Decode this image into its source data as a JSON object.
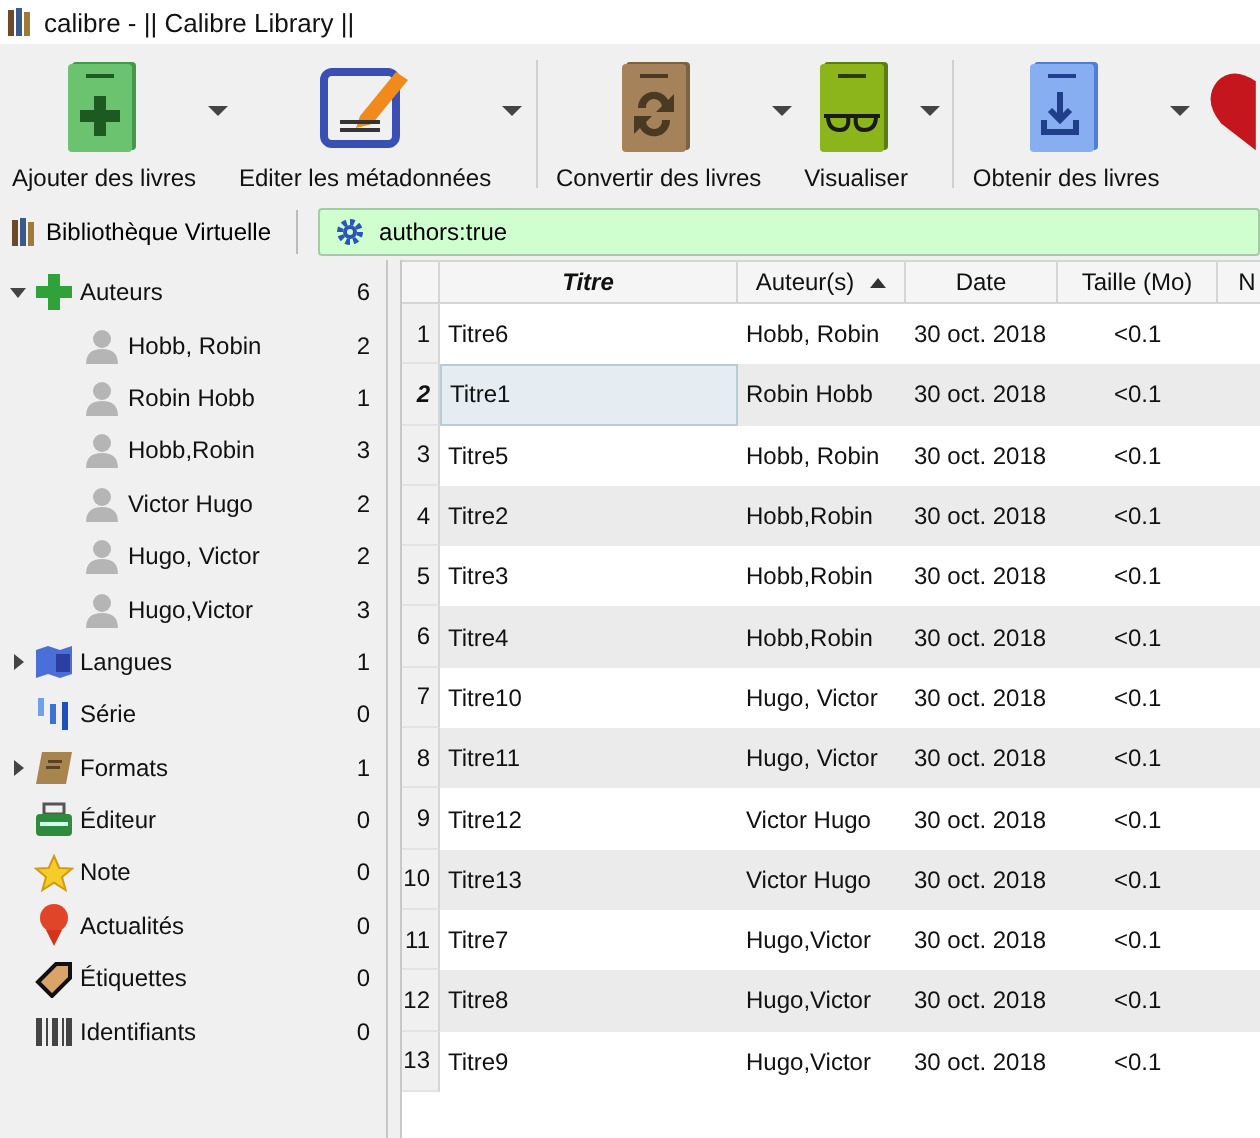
{
  "window": {
    "title": "calibre - || Calibre Library ||"
  },
  "toolbar": [
    {
      "label": "Ajouter des livres"
    },
    {
      "label": "Editer les métadonnées"
    },
    {
      "label": "Convertir des livres"
    },
    {
      "label": "Visualiser"
    },
    {
      "label": "Obtenir des livres"
    }
  ],
  "virtual_library": {
    "label": "Bibliothèque Virtuelle"
  },
  "search": {
    "value": "authors:true"
  },
  "sidebar": {
    "items": [
      {
        "label": "Auteurs",
        "count": "6",
        "kind": "branch",
        "expanded": true,
        "children": [
          {
            "label": "Hobb, Robin",
            "count": "2"
          },
          {
            "label": "Robin Hobb",
            "count": "1"
          },
          {
            "label": "Hobb,Robin",
            "count": "3"
          },
          {
            "label": "Victor Hugo",
            "count": "2"
          },
          {
            "label": "Hugo, Victor",
            "count": "2"
          },
          {
            "label": "Hugo,Victor",
            "count": "3"
          }
        ]
      },
      {
        "label": "Langues",
        "count": "1",
        "kind": "branch",
        "expanded": false
      },
      {
        "label": "Série",
        "count": "0",
        "kind": "leaf"
      },
      {
        "label": "Formats",
        "count": "1",
        "kind": "branch",
        "expanded": false
      },
      {
        "label": "Éditeur",
        "count": "0",
        "kind": "leaf"
      },
      {
        "label": "Note",
        "count": "0",
        "kind": "leaf"
      },
      {
        "label": "Actualités",
        "count": "0",
        "kind": "leaf"
      },
      {
        "label": "Étiquettes",
        "count": "0",
        "kind": "leaf"
      },
      {
        "label": "Identifiants",
        "count": "0",
        "kind": "leaf"
      }
    ]
  },
  "table": {
    "columns": [
      {
        "label": "Titre",
        "sorted": false
      },
      {
        "label": "Auteur(s)",
        "sorted": true
      },
      {
        "label": "Date",
        "sorted": false
      },
      {
        "label": "Taille (Mo)",
        "sorted": false
      },
      {
        "label": "N",
        "sorted": false
      }
    ],
    "rows": [
      {
        "number": "1",
        "title": "Titre6",
        "author": "Hobb, Robin",
        "date": "30 oct. 2018",
        "size": "<0.1",
        "selected": false
      },
      {
        "number": "2",
        "title": "Titre1",
        "author": "Robin Hobb",
        "date": "30 oct. 2018",
        "size": "<0.1",
        "selected": true
      },
      {
        "number": "3",
        "title": "Titre5",
        "author": "Hobb, Robin",
        "date": "30 oct. 2018",
        "size": "<0.1",
        "selected": false
      },
      {
        "number": "4",
        "title": "Titre2",
        "author": "Hobb,Robin",
        "date": "30 oct. 2018",
        "size": "<0.1",
        "selected": false
      },
      {
        "number": "5",
        "title": "Titre3",
        "author": "Hobb,Robin",
        "date": "30 oct. 2018",
        "size": "<0.1",
        "selected": false
      },
      {
        "number": "6",
        "title": "Titre4",
        "author": "Hobb,Robin",
        "date": "30 oct. 2018",
        "size": "<0.1",
        "selected": false
      },
      {
        "number": "7",
        "title": "Titre10",
        "author": "Hugo, Victor",
        "date": "30 oct. 2018",
        "size": "<0.1",
        "selected": false
      },
      {
        "number": "8",
        "title": "Titre11",
        "author": "Hugo, Victor",
        "date": "30 oct. 2018",
        "size": "<0.1",
        "selected": false
      },
      {
        "number": "9",
        "title": "Titre12",
        "author": "Victor Hugo",
        "date": "30 oct. 2018",
        "size": "<0.1",
        "selected": false
      },
      {
        "number": "10",
        "title": "Titre13",
        "author": "Victor Hugo",
        "date": "30 oct. 2018",
        "size": "<0.1",
        "selected": false
      },
      {
        "number": "11",
        "title": "Titre7",
        "author": "Hugo,Victor",
        "date": "30 oct. 2018",
        "size": "<0.1",
        "selected": false
      },
      {
        "number": "12",
        "title": "Titre8",
        "author": "Hugo,Victor",
        "date": "30 oct. 2018",
        "size": "<0.1",
        "selected": false
      },
      {
        "number": "13",
        "title": "Titre9",
        "author": "Hugo,Victor",
        "date": "30 oct. 2018",
        "size": "<0.1",
        "selected": false
      }
    ]
  }
}
